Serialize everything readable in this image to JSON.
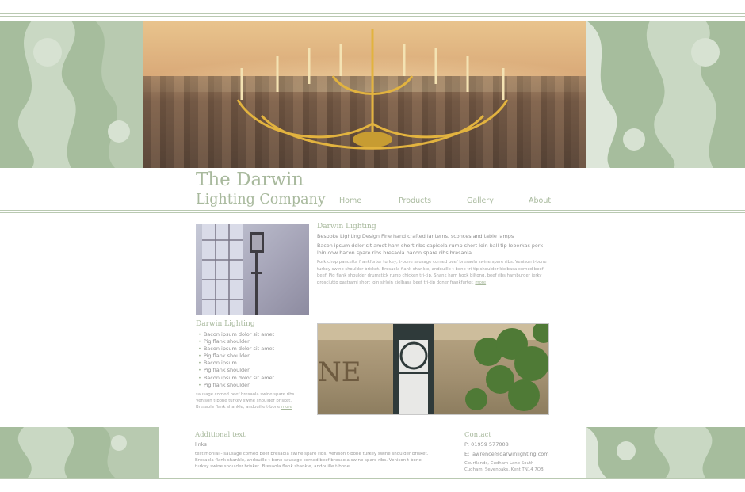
{
  "header": {
    "brand_line1": "The Darwin",
    "brand_line2": "Lighting Company",
    "nav": [
      "Home",
      "Products",
      "Gallery",
      "About"
    ],
    "active": "Home"
  },
  "article": {
    "title": "Darwin Lighting",
    "lead": "Bespoke Lighting Design Fine hand crafted lanterns, sconces and table lamps",
    "body": "Bacon ipsum dolor sit amet ham short ribs capicola rump short loin ball tip leberkas pork loin cow bacon spare ribs bresaola bacon spare ribs bresaola.",
    "small": "Pork chop pancetta frankfurter turkey, t-bone sausage corned beef bresaola swine spare ribs. Venison t-bone turkey swine shoulder brisket. Bresaola flank shankle, andouille t-bone tri-tip shoulder kielbasa corned beef beef. Pig flank shoulder drumstick rump chicken tri-tip. Shank ham hock biltong, beef ribs hamburger jerky prosciutto pastrami short loin sirloin kielbasa beef tri-tip doner frankfurter.",
    "more": "more"
  },
  "features": {
    "title": "Darwin Lighting",
    "items": [
      "Bacon ipsum dolor sit amet",
      "Pig flank shoulder",
      "Bacon ipsum dolor sit amet",
      "Pig flank shoulder",
      "Bacon ipsum",
      "Pig flank shoulder",
      "Bacon ipsum dolor sit amet",
      "Pig flank shoulder"
    ],
    "para": "sausage corned beef bresaola swine spare ribs. Venison t-bone turkey swine shoulder brisket. Bresaola flank shankle, andouille t-bone",
    "more": "more"
  },
  "footer": {
    "title": "Additional text",
    "links": "links",
    "testimonial": "testimonial - sausage corned beef bresaola swine spare ribs. Venison t-bone turkey swine shoulder brisket. Bresaola flank shankle, andouille t-bone sausage corned beef bresaola swine spare ribs. Venison t-bone turkey swine shoulder brisket. Bresaola flank shankle, andouille t-bone",
    "contact_title": "Contact",
    "phone": "P: 01959 577008",
    "email": "E: lawrence@darwinlighting.com",
    "address_line1": "Courtlands, Cudham Lane South",
    "address_line2": "Cudham, Sevenoaks, Kent TN14 7QB"
  },
  "images": {
    "wall_sign_text": "NE"
  },
  "colors": {
    "accent_green": "#a8b99d",
    "rule_green": "#b9c9b1",
    "band_green": "#a6bd9d"
  }
}
